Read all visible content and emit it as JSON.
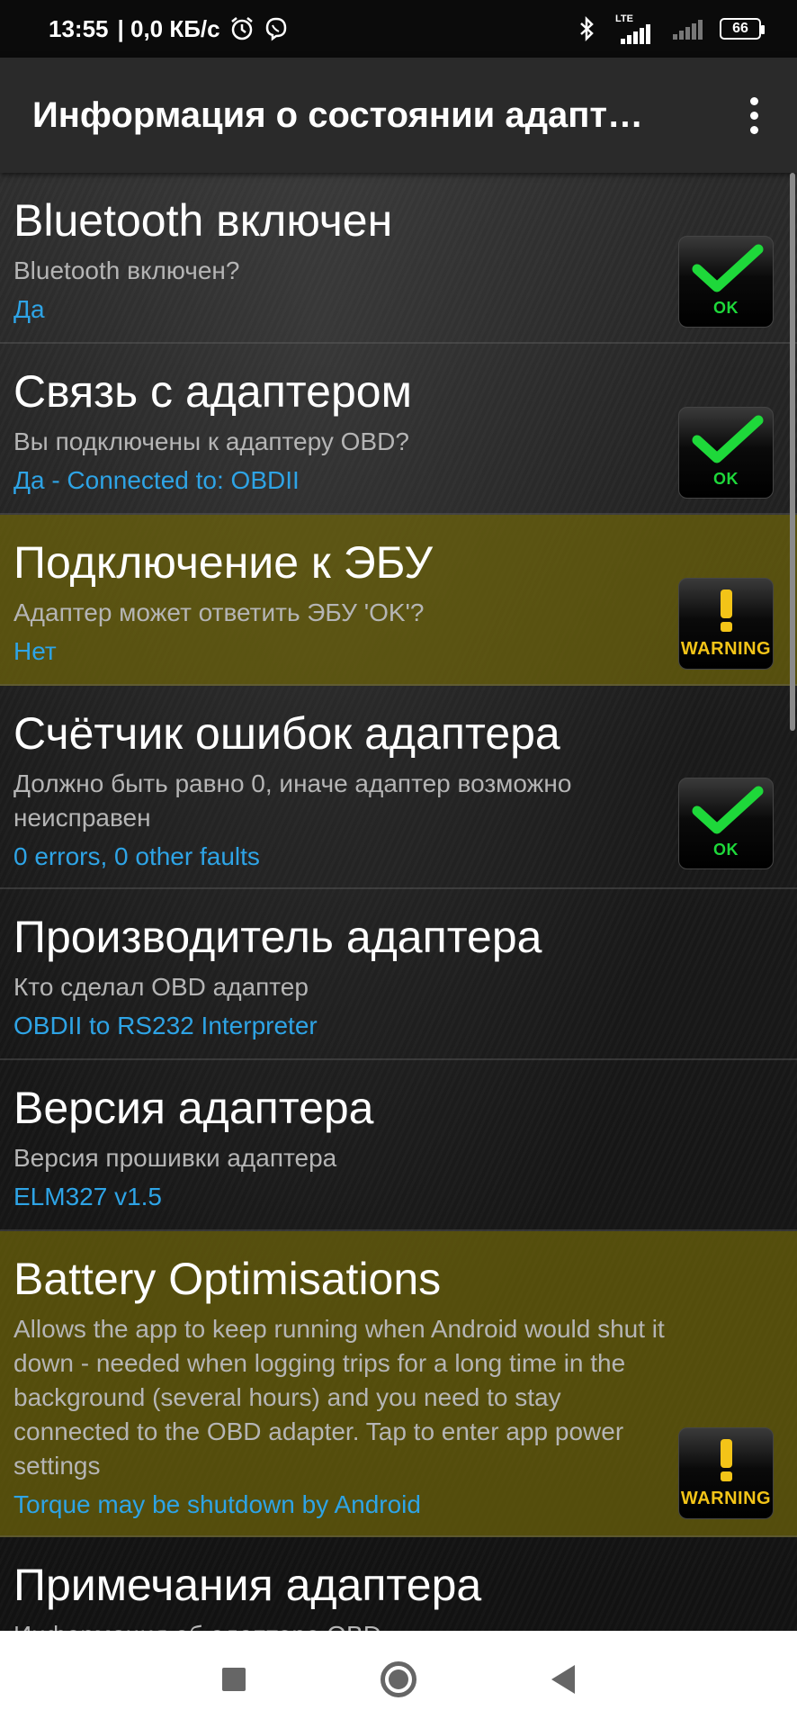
{
  "status_bar": {
    "time": "13:55",
    "net_speed": "| 0,0 КБ/с",
    "lte_label": "LTE",
    "battery": "66"
  },
  "app_bar": {
    "title": "Информация о состоянии адапт…"
  },
  "items": [
    {
      "title": "Bluetooth включен",
      "subtitle": "Bluetooth включен?",
      "value": "Да",
      "status": "OK",
      "status_icon": "check-icon"
    },
    {
      "title": "Связь с адаптером",
      "subtitle": "Вы подключены к адаптеру OBD?",
      "value": "Да - Connected to: OBDII",
      "status": "OK",
      "status_icon": "check-icon"
    },
    {
      "title": "Подключение к ЭБУ",
      "subtitle": "Адаптер может ответить ЭБУ 'OK'?",
      "value": "Нет",
      "status": "WARNING",
      "status_icon": "exclamation-icon"
    },
    {
      "title": "Счётчик ошибок адаптера",
      "subtitle": "Должно быть равно 0, иначе адаптер возможно неисправен",
      "value": "0 errors, 0 other faults",
      "status": "OK",
      "status_icon": "check-icon"
    },
    {
      "title": "Производитель адаптера",
      "subtitle": "Кто сделал OBD адаптер",
      "value": "OBDII to RS232 Interpreter"
    },
    {
      "title": "Версия адаптера",
      "subtitle": "Версия прошивки адаптера",
      "value": "ELM327 v1.5"
    },
    {
      "title": "Battery Optimisations",
      "subtitle": "Allows the app to keep running when Android would shut it down - needed when logging trips for a long time in the background (several hours) and you need to stay connected to the OBD adapter. Tap to enter app power settings",
      "value": "Torque may be shutdown by Android",
      "status": "WARNING",
      "status_icon": "exclamation-icon"
    },
    {
      "title": "Примечания адаптера",
      "subtitle": "Информация об адаптере OBD"
    }
  ],
  "colors": {
    "accent_value": "#2ea4e6",
    "warning_row": "#6e640a",
    "ok_green": "#1ed83a",
    "warning_yellow": "#f3c418"
  }
}
